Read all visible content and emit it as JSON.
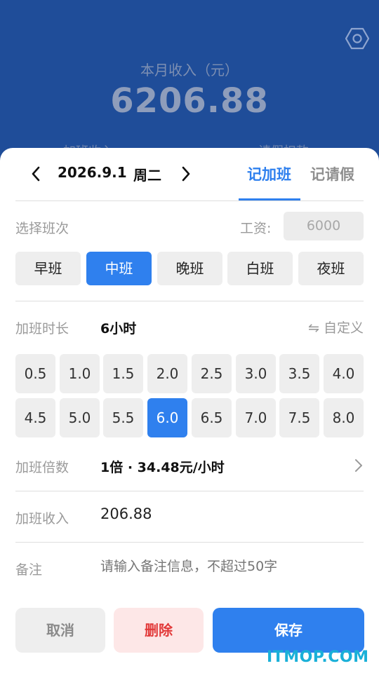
{
  "header": {
    "income_label": "本月收入（元）",
    "income_value": "6206.88",
    "sub_left": "加班收入",
    "sub_right": "请假扣款"
  },
  "date_bar": {
    "date": "2026.9.1",
    "weekday": "周二",
    "tabs": [
      {
        "label": "记加班",
        "active": true
      },
      {
        "label": "记请假",
        "active": false
      }
    ]
  },
  "shift_section": {
    "label": "选择班次",
    "wage_label": "工资:",
    "wage_placeholder": "6000",
    "shifts": [
      {
        "label": "早班",
        "active": false
      },
      {
        "label": "中班",
        "active": true
      },
      {
        "label": "晚班",
        "active": false
      },
      {
        "label": "白班",
        "active": false
      },
      {
        "label": "夜班",
        "active": false
      }
    ]
  },
  "hours_section": {
    "label": "加班时长",
    "value": "6小时",
    "custom_label": "⇋ 自定义",
    "options": [
      "0.5",
      "1.0",
      "1.5",
      "2.0",
      "2.5",
      "3.0",
      "3.5",
      "4.0",
      "4.5",
      "5.0",
      "5.5",
      "6.0",
      "6.5",
      "7.0",
      "7.5",
      "8.0"
    ],
    "selected": "6.0"
  },
  "multiplier_section": {
    "label": "加班倍数",
    "value": "1倍 · 34.48元/小时"
  },
  "income_section": {
    "label": "加班收入",
    "value": "206.88"
  },
  "remark_section": {
    "label": "备注",
    "placeholder": "请输入备注信息，不超过50字"
  },
  "buttons": {
    "cancel": "取消",
    "delete": "删除",
    "save": "保存"
  },
  "watermark": "ITMOP.COM",
  "colors": {
    "accent": "#2f80ee",
    "header_bg": "#1f4d99",
    "delete_text": "#e23a3a",
    "delete_bg": "#fde7e7"
  }
}
